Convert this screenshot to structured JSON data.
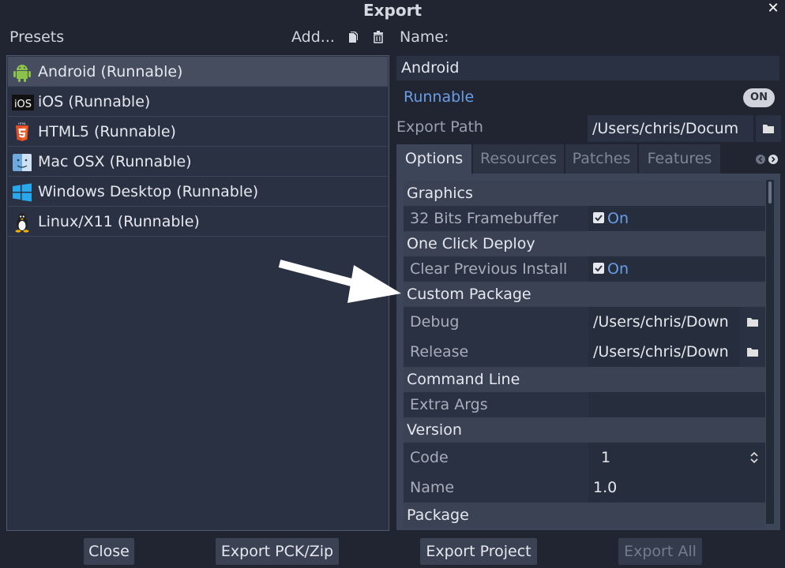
{
  "window": {
    "title": "Export",
    "close_glyph": "✕"
  },
  "presets": {
    "header": "Presets",
    "add_label": "Add...",
    "duplicate_icon": "duplicate-icon",
    "delete_icon": "trash-icon",
    "items": [
      {
        "label": "Android (Runnable)",
        "icon": "android-icon",
        "selected": true
      },
      {
        "label": "iOS (Runnable)",
        "icon": "ios-icon",
        "selected": false
      },
      {
        "label": "HTML5 (Runnable)",
        "icon": "html5-icon",
        "selected": false
      },
      {
        "label": "Mac OSX (Runnable)",
        "icon": "macosx-icon",
        "selected": false
      },
      {
        "label": "Windows Desktop (Runnable)",
        "icon": "windows-icon",
        "selected": false
      },
      {
        "label": "Linux/X11 (Runnable)",
        "icon": "linux-icon",
        "selected": false
      }
    ]
  },
  "details": {
    "name_label": "Name:",
    "name_value": "Android",
    "runnable_label": "Runnable",
    "runnable_toggle": "ON",
    "export_path_label": "Export Path",
    "export_path_value": "/Users/chris/Docum",
    "tabs": [
      "Options",
      "Resources",
      "Patches",
      "Features"
    ],
    "active_tab": "Options"
  },
  "options": {
    "graphics": "Graphics",
    "fb32_label": "32 Bits Framebuffer",
    "fb32_value": "On",
    "one_click": "One Click Deploy",
    "clear_label": "Clear Previous Install",
    "clear_value": "On",
    "custom_package": "Custom Package",
    "debug_label": "Debug",
    "debug_value": "/Users/chris/Down",
    "release_label": "Release",
    "release_value": "/Users/chris/Down",
    "command_line": "Command Line",
    "extra_args_label": "Extra Args",
    "extra_args_value": "",
    "version": "Version",
    "code_label": "Code",
    "code_value": "1",
    "name_label": "Name",
    "name_value": "1.0",
    "package": "Package"
  },
  "buttons": {
    "close": "Close",
    "export_pck": "Export PCK/Zip",
    "export_project": "Export Project",
    "export_all": "Export All"
  },
  "colors": {
    "background": "#202531",
    "accent_blue": "#6a9ee8",
    "selected_row": "#454d5f",
    "arrow": "#ffffff"
  }
}
